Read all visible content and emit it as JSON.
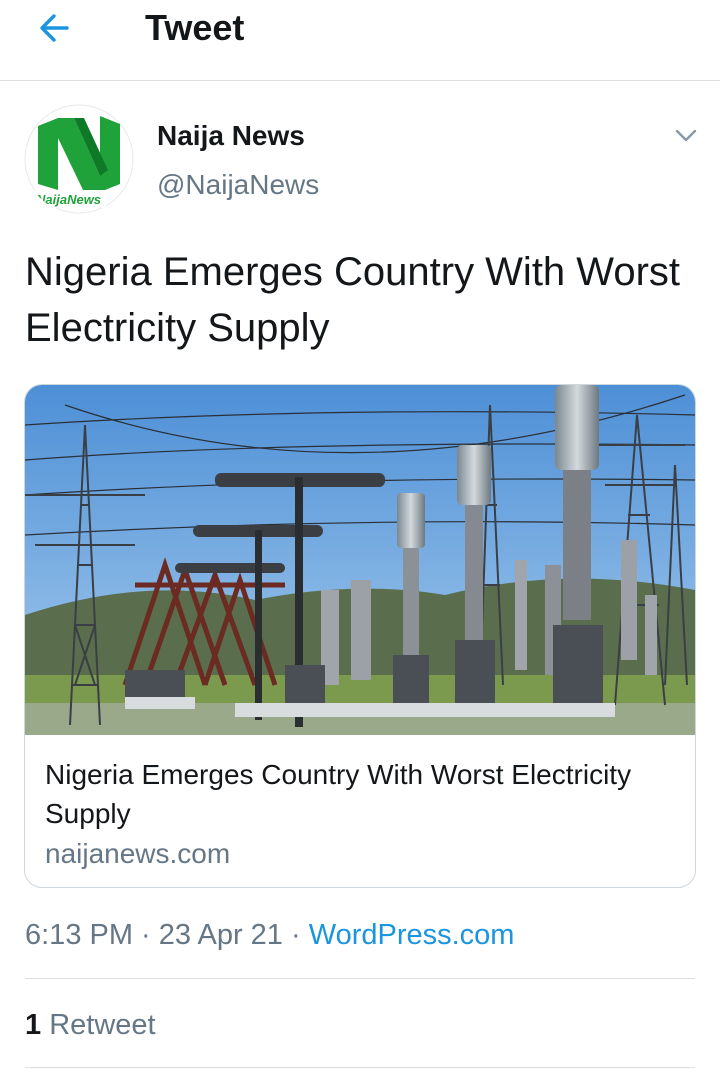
{
  "header": {
    "title": "Tweet",
    "back_icon": "arrow-left-icon",
    "accent_color": "#1b95e0"
  },
  "author": {
    "name": "Naija News",
    "handle": "@NaijaNews",
    "avatar_icon": "naija-news-logo",
    "avatar_text": "NaijaNews",
    "menu_icon": "chevron-down-icon"
  },
  "tweet": {
    "text": "Nigeria Emerges Country With Worst Electricity Supply"
  },
  "card": {
    "image": "electrical-substation-photo",
    "title": "Nigeria Emerges Country With Worst Electricity Supply",
    "domain": "naijanews.com"
  },
  "meta": {
    "time": "6:13 PM",
    "separator1": " · ",
    "date": "23 Apr 21",
    "separator2": " · ",
    "source": "WordPress.com"
  },
  "stats": {
    "retweets_count": "1",
    "retweets_label": "Retweet"
  },
  "colors": {
    "text_primary": "#14171a",
    "text_secondary": "#657786",
    "border": "#dcdfe2",
    "logo_green": "#1fa23a"
  }
}
